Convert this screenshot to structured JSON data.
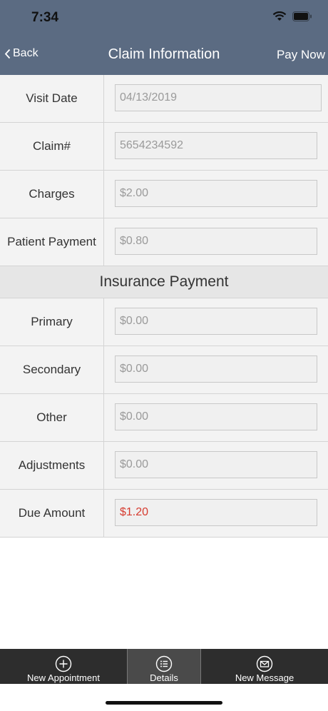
{
  "status_bar": {
    "time": "7:34"
  },
  "nav": {
    "back_label": "Back",
    "title": "Claim Information",
    "action_label": "Pay Now"
  },
  "rows_top": [
    {
      "label": "Visit Date",
      "value": "04/13/2019"
    },
    {
      "label": "Claim#",
      "value": "5654234592"
    },
    {
      "label": "Charges",
      "value": "$2.00"
    },
    {
      "label": "Patient Payment",
      "value": "$0.80"
    }
  ],
  "section_title": "Insurance Payment",
  "rows_insurance": [
    {
      "label": "Primary",
      "value": "$0.00"
    },
    {
      "label": "Secondary",
      "value": "$0.00"
    },
    {
      "label": "Other",
      "value": "$0.00"
    },
    {
      "label": "Adjustments",
      "value": "$0.00"
    },
    {
      "label": "Due Amount",
      "value": "$1.20"
    }
  ],
  "tabs": [
    {
      "label": "New Appointment",
      "icon": "plus-circle-icon"
    },
    {
      "label": "Details",
      "icon": "list-icon"
    },
    {
      "label": "New Message",
      "icon": "envelope-icon"
    }
  ],
  "colors": {
    "nav_bg": "#5b6b82",
    "tabbar_bg": "#2d2d2d",
    "due_amount": "#d63b2f"
  }
}
